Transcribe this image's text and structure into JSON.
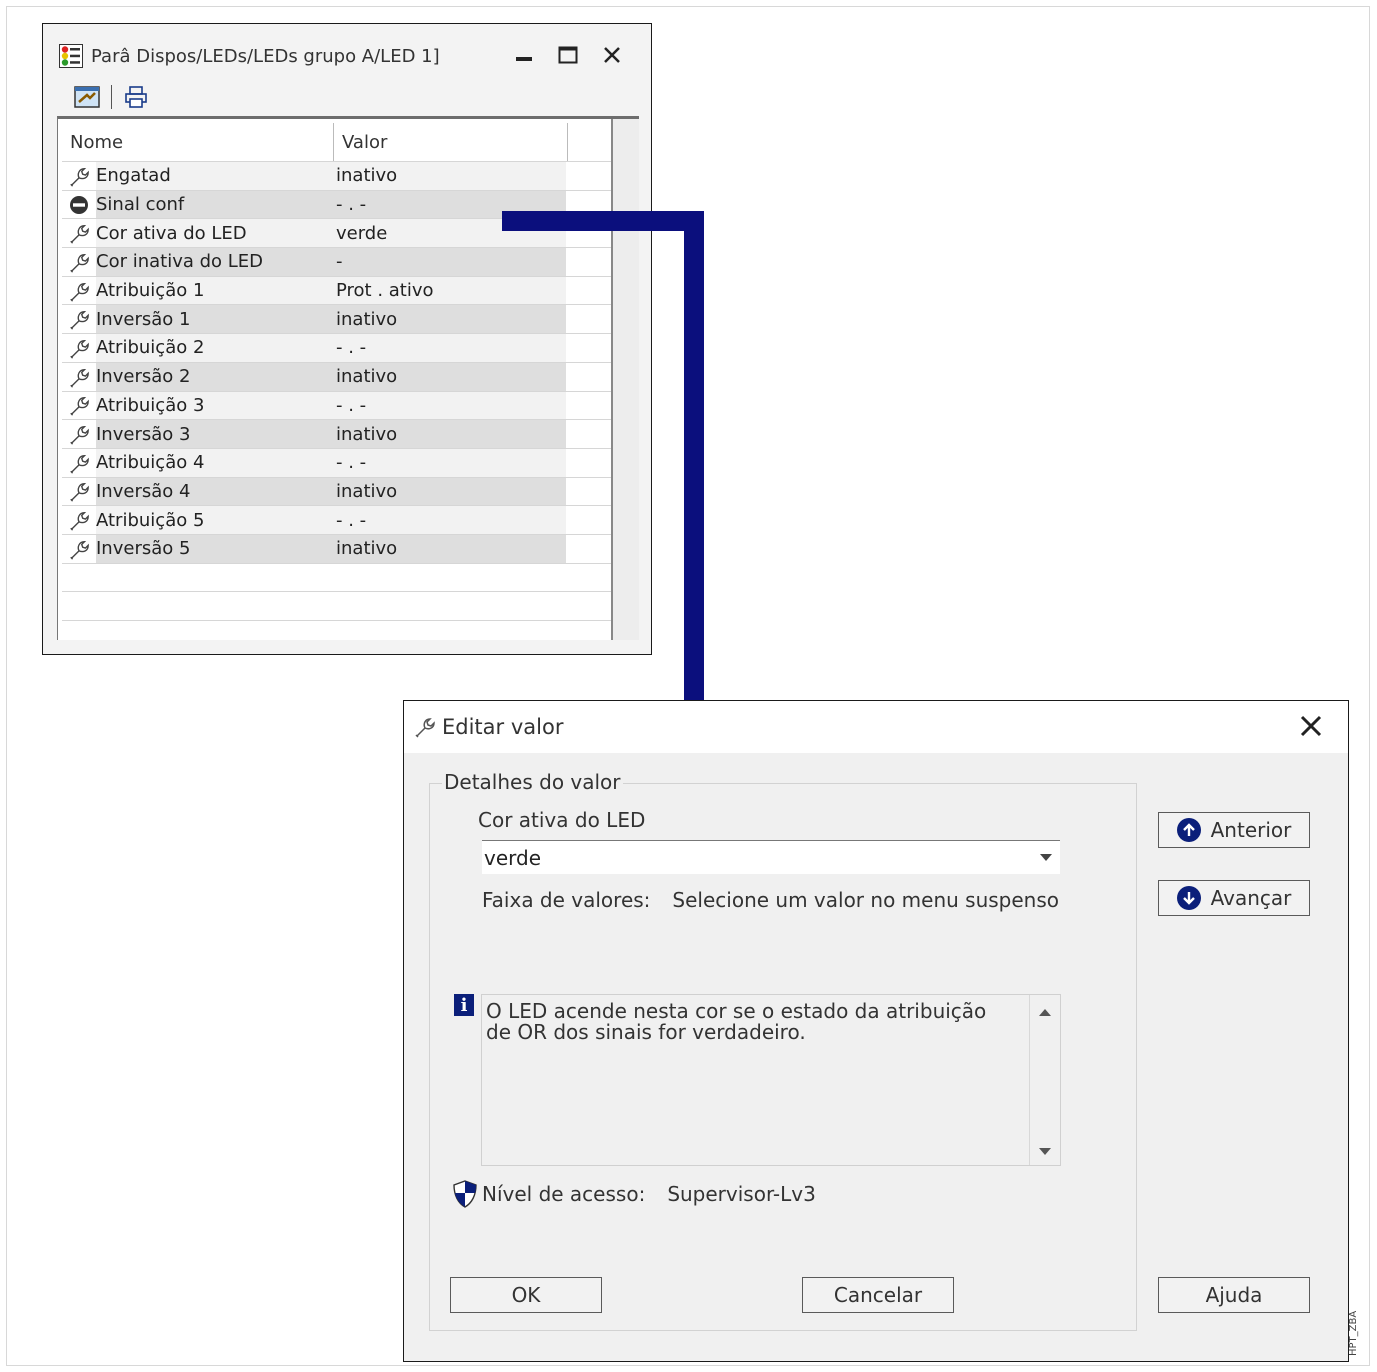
{
  "param_window": {
    "title": "Parâ Dispos/LEDs/LEDs grupo A/LED 1]",
    "columns": {
      "name": "Nome",
      "value": "Valor"
    },
    "rows": [
      {
        "icon": "wrench-icon",
        "name": "Engatad",
        "value": "inativo"
      },
      {
        "icon": "no-entry-icon",
        "name": "Sinal conf",
        "value": "- . -"
      },
      {
        "icon": "wrench-icon",
        "name": "Cor ativa do LED",
        "value": "verde"
      },
      {
        "icon": "wrench-icon",
        "name": "Cor inativa do LED",
        "value": "-"
      },
      {
        "icon": "wrench-icon",
        "name": "Atribuição 1",
        "value": "Prot . ativo"
      },
      {
        "icon": "wrench-icon",
        "name": "Inversão 1",
        "value": "inativo"
      },
      {
        "icon": "wrench-icon",
        "name": "Atribuição 2",
        "value": "- . -"
      },
      {
        "icon": "wrench-icon",
        "name": "Inversão 2",
        "value": "inativo"
      },
      {
        "icon": "wrench-icon",
        "name": "Atribuição 3",
        "value": "- . -"
      },
      {
        "icon": "wrench-icon",
        "name": "Inversão 3",
        "value": "inativo"
      },
      {
        "icon": "wrench-icon",
        "name": "Atribuição 4",
        "value": "- . -"
      },
      {
        "icon": "wrench-icon",
        "name": "Inversão 4",
        "value": "inativo"
      },
      {
        "icon": "wrench-icon",
        "name": "Atribuição 5",
        "value": "- . -"
      },
      {
        "icon": "wrench-icon",
        "name": "Inversão 5",
        "value": "inativo"
      }
    ]
  },
  "edit_dialog": {
    "title": "Editar valor",
    "group_title": "Detalhes do valor",
    "param_label": "Cor ativa do LED",
    "selected_value": "verde",
    "range_label": "Faixa de valores:",
    "range_text": "Selecione um valor no menu suspenso",
    "info_text": "O LED acende nesta cor se o estado da atribuição de OR dos sinais for verdadeiro.",
    "access_label": "Nível de acesso:",
    "access_value": "Supervisor-Lv3",
    "buttons": {
      "prev": "Anterior",
      "next": "Avançar",
      "ok": "OK",
      "cancel": "Cancelar",
      "help": "Ajuda"
    }
  },
  "watermark": "HPT_ZBA",
  "colors": {
    "arrow": "#0b0f7d",
    "accent": "#0b1f7a"
  }
}
